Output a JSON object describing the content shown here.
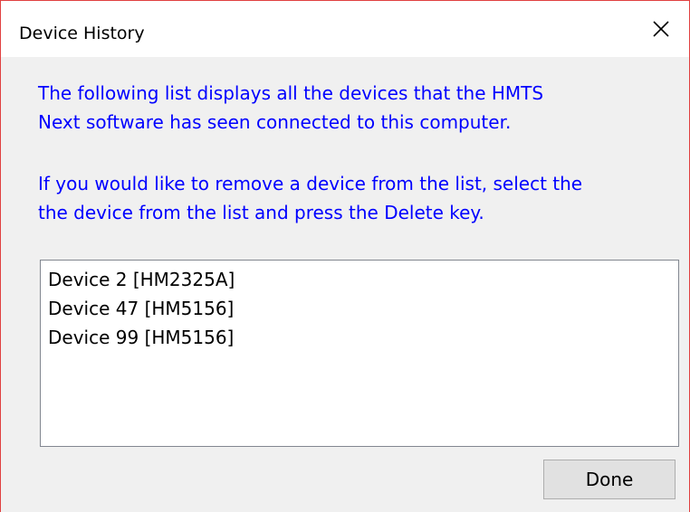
{
  "window": {
    "title": "Device History",
    "close_icon": "close-icon"
  },
  "info": {
    "paragraph1": [
      "The following list displays all the devices that the HMTS",
      "Next software has seen connected to this computer."
    ],
    "paragraph2": [
      "If you would like to remove a device from the list, select the",
      "the device from the list and press the Delete key."
    ],
    "text_color": "#0000ff"
  },
  "device_list": {
    "items": [
      "Device 2 [HM2325A]",
      "Device 47 [HM5156]",
      "Device 99 [HM5156]"
    ]
  },
  "buttons": {
    "done_label": "Done"
  }
}
